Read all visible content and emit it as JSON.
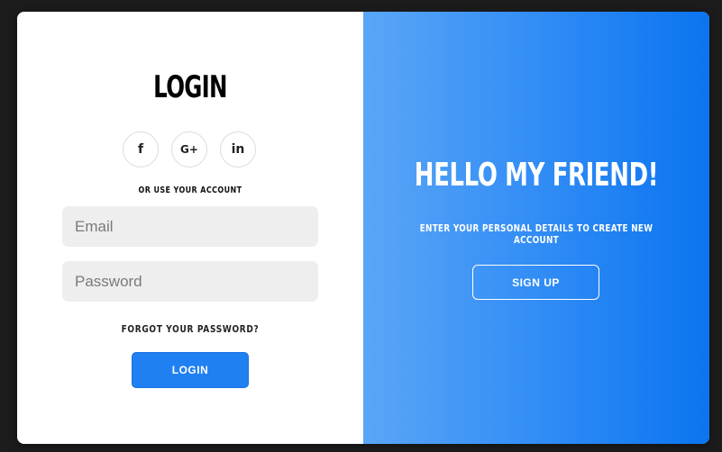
{
  "login_panel": {
    "title": "LOGIN",
    "social_buttons": [
      {
        "icon": "facebook-icon",
        "glyph": "f"
      },
      {
        "icon": "google-plus-icon",
        "glyph": "G+"
      },
      {
        "icon": "linkedin-icon",
        "glyph": "in"
      }
    ],
    "alt_text": "OR USE YOUR ACCOUNT",
    "email_placeholder": "Email",
    "password_placeholder": "Password",
    "forgot_label": "FORGOT YOUR PASSWORD?",
    "login_button": "LOGIN"
  },
  "signup_panel": {
    "heading": "HELLO MY FRIEND!",
    "message": "ENTER YOUR PERSONAL DETAILS TO CREATE NEW ACCOUNT",
    "signup_button": "SIGN UP"
  },
  "colors": {
    "accent": "#1f80f2",
    "gradient_start": "#5aa6f7",
    "gradient_end": "#0a74f0",
    "input_bg": "#eeeeee"
  }
}
